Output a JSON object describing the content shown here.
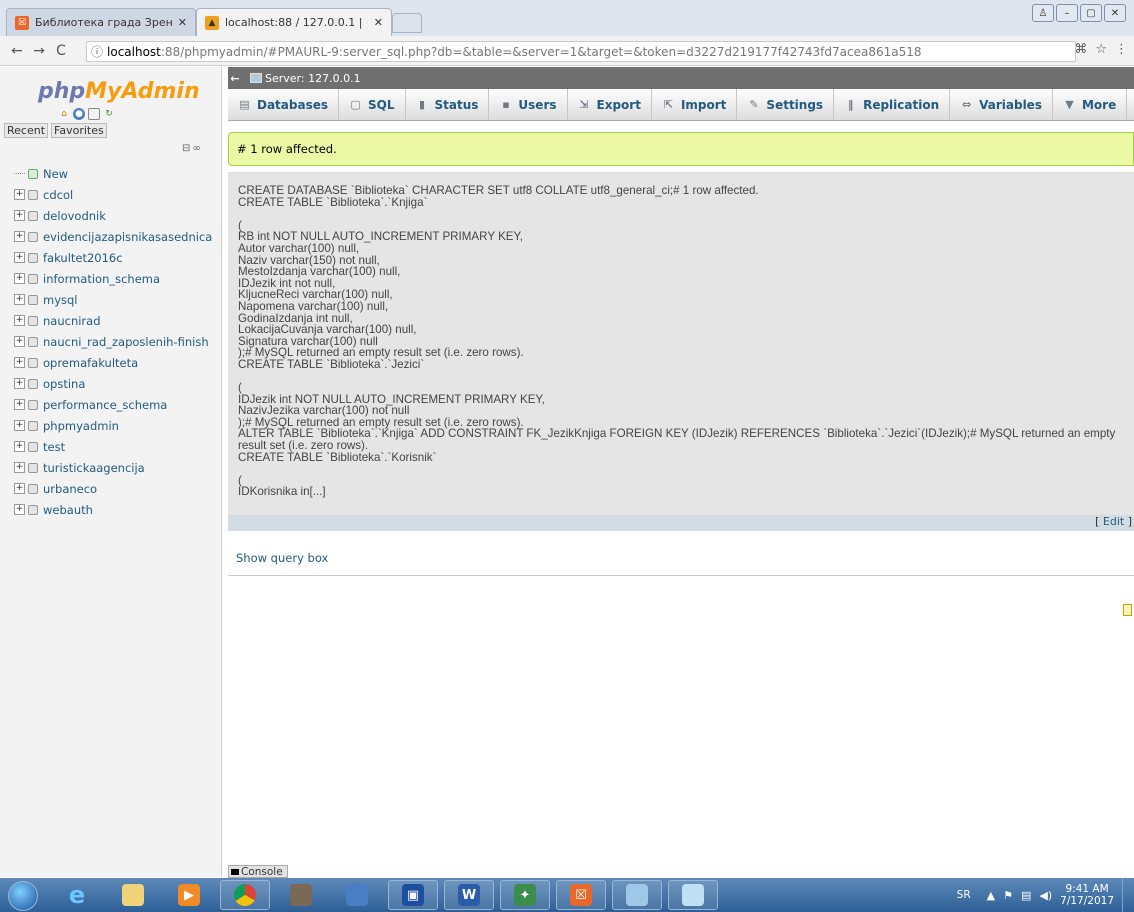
{
  "browser": {
    "tabs": [
      {
        "title": "Библиотека града Зрен",
        "active": false,
        "favicon": "xampp-icon"
      },
      {
        "title": "localhost:88 / 127.0.0.1 |",
        "active": true,
        "favicon": "phpmyadmin-icon"
      }
    ],
    "url_host": "localhost",
    "url_rest": ":88/phpmyadmin/#PMAURL-9:server_sql.php?db=&table=&server=1&target=&token=d3227d219177f42743fd7acea861a518"
  },
  "sidebar": {
    "logo_php": "php",
    "logo_my": "MyAdmin",
    "recent_label": "Recent",
    "favorites_label": "Favorites",
    "new_label": "New",
    "databases": [
      "cdcol",
      "delovodnik",
      "evidencijazapisnikasasednica",
      "fakultet2016c",
      "information_schema",
      "mysql",
      "naucnirad",
      "naucni_rad_zaposlenih-finish",
      "opremafakulteta",
      "opstina",
      "performance_schema",
      "phpmyadmin",
      "test",
      "turistickaagencija",
      "urbaneco",
      "webauth"
    ]
  },
  "main": {
    "server_label": "Server: 127.0.0.1",
    "menu": [
      {
        "label": "Databases",
        "icon": "database-icon"
      },
      {
        "label": "SQL",
        "icon": "sql-icon"
      },
      {
        "label": "Status",
        "icon": "status-icon"
      },
      {
        "label": "Users",
        "icon": "users-icon"
      },
      {
        "label": "Export",
        "icon": "export-icon"
      },
      {
        "label": "Import",
        "icon": "import-icon"
      },
      {
        "label": "Settings",
        "icon": "settings-icon"
      },
      {
        "label": "Replication",
        "icon": "replication-icon"
      },
      {
        "label": "Variables",
        "icon": "variables-icon"
      },
      {
        "label": "More",
        "icon": "chevron-down-icon"
      }
    ],
    "success_message": "# 1 row affected.",
    "sql_text": "CREATE DATABASE `Biblioteka` CHARACTER SET utf8 COLLATE utf8_general_ci;# 1 row affected.\nCREATE TABLE `Biblioteka`.`Knjiga`\n\n(\nRB int NOT NULL AUTO_INCREMENT PRIMARY KEY,\nAutor varchar(100) null,\nNaziv varchar(150) not null,\nMestoIzdanja varchar(100) null,\nIDJezik int not null,\nKljucneReci varchar(100) null,\nNapomena varchar(100) null,\nGodinaIzdanja int null,\nLokacijaCuvanja varchar(100) null,\nSignatura varchar(100) null\n);# MySQL returned an empty result set (i.e. zero rows).\nCREATE TABLE `Biblioteka`.`Jezici`\n\n(\nIDJezik int NOT NULL AUTO_INCREMENT PRIMARY KEY,\nNazivJezika varchar(100) not null\n);# MySQL returned an empty result set (i.e. zero rows).\nALTER TABLE `Biblioteka`.`Knjiga` ADD CONSTRAINT FK_JezikKnjiga FOREIGN KEY (IDJezik) REFERENCES `Biblioteka`.`Jezici`(IDJezik);# MySQL returned an empty result set (i.e. zero rows).\nCREATE TABLE `Biblioteka`.`Korisnik`\n\n(\nIDKorisnika in[...]",
    "edit_label": "Edit",
    "show_query_label": "Show query box",
    "console_label": "Console"
  },
  "taskbar": {
    "lang": "SR",
    "time": "9:41 AM",
    "date": "7/17/2017"
  }
}
